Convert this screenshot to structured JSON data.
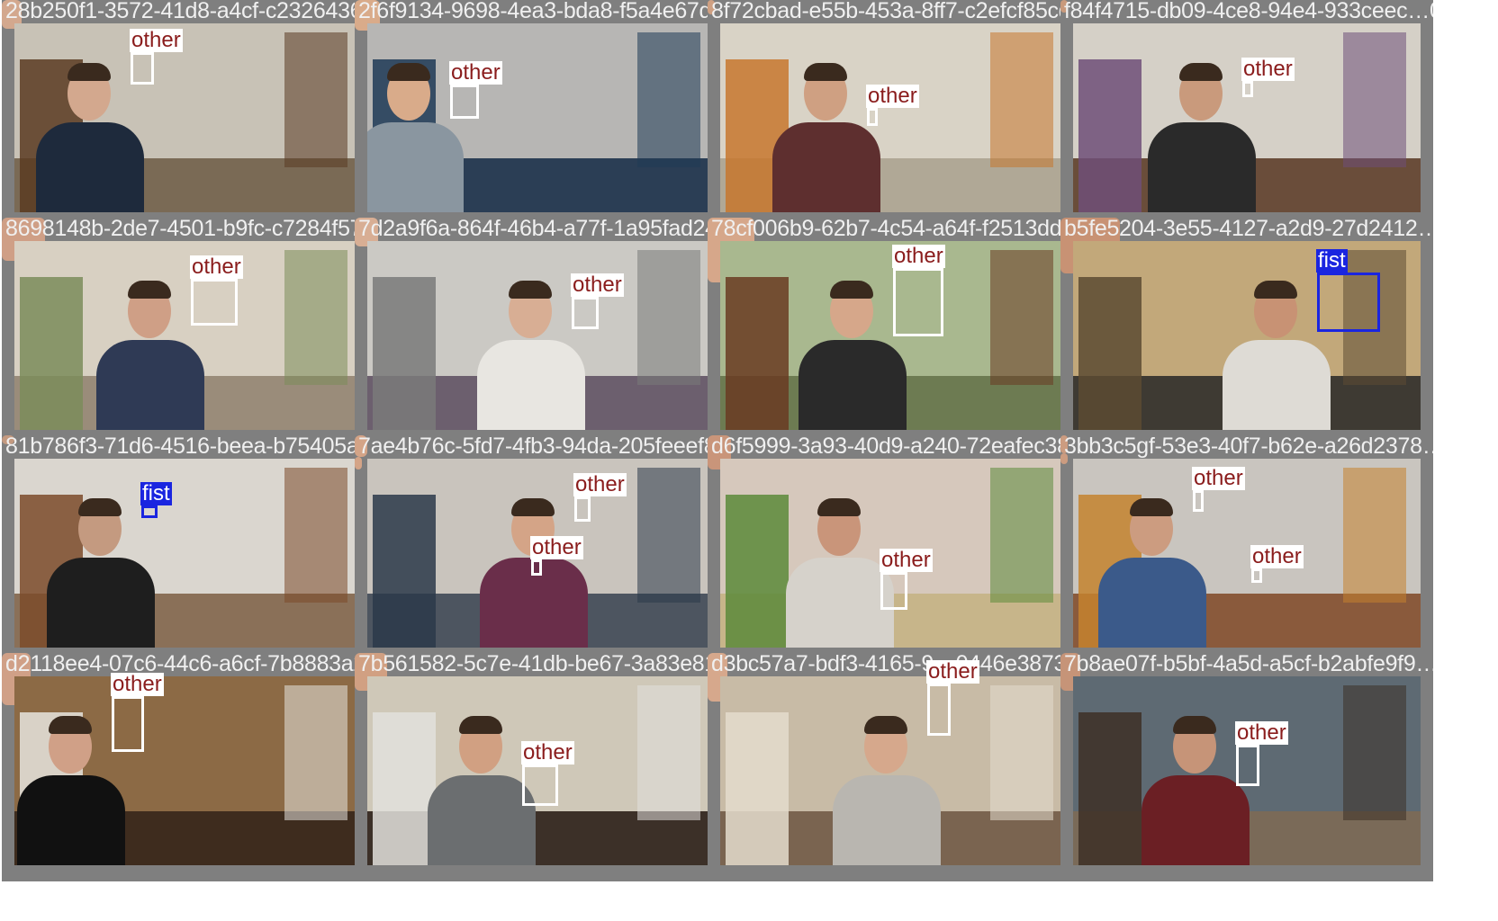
{
  "tiles": [
    {
      "filename": "28b250f1-3572-41d8-a4cf-c2326436d…1e3.jpg",
      "scene": {
        "wall": "#c8c2b6",
        "floor": "#7a6a55",
        "shirt": "#1e2a3c",
        "skin": "#d3a88e",
        "accent": "#5a3b22"
      },
      "detections": [
        {
          "label": "other",
          "color": "#ffffff",
          "text_color": "#8a1c1c"
        }
      ]
    },
    {
      "filename": "2f6f9134-9698-4ea3-bda8-f5a4e67d5721.jpg",
      "scene": {
        "wall": "#b7b6b4",
        "floor": "#2b3e55",
        "shirt": "#8a96a0",
        "skin": "#d9ab8a",
        "accent": "#1f3a56"
      },
      "detections": [
        {
          "label": "other",
          "color": "#ffffff",
          "text_color": "#8a1c1c"
        }
      ]
    },
    {
      "filename": "8f72cbad-e55b-453a-8ff7-c2efcf85cd09.jpg",
      "scene": {
        "wall": "#d9d3c6",
        "floor": "#b0a896",
        "shirt": "#5e2f2f",
        "skin": "#cfa082",
        "accent": "#c7772e"
      },
      "detections": [
        {
          "label": "other",
          "color": "#ffffff",
          "text_color": "#8a1c1c"
        }
      ]
    },
    {
      "filename": "f84f4715-db09-4ce8-94e4-933ceec…0.jpg",
      "scene": {
        "wall": "#d5d0c7",
        "floor": "#6a4d3a",
        "shirt": "#2a2a2a",
        "skin": "#c99a7c",
        "accent": "#6e4f78"
      },
      "detections": [
        {
          "label": "other",
          "color": "#ffffff",
          "text_color": "#8a1c1c"
        }
      ]
    },
    {
      "filename": "8698148b-2de7-4501-b9fc-c7284f577f12.jpg",
      "scene": {
        "wall": "#d8d0c2",
        "floor": "#9a8c7a",
        "shirt": "#2f3a55",
        "skin": "#cf9f86",
        "accent": "#7b8c5a"
      },
      "detections": [
        {
          "label": "other",
          "color": "#ffffff",
          "text_color": "#8a1c1c"
        }
      ]
    },
    {
      "filename": "7d2a9f6a-864f-46b4-a77f-1a95fad24788.jpg",
      "scene": {
        "wall": "#cbc9c4",
        "floor": "#6c5f6e",
        "shirt": "#e8e6e1",
        "skin": "#d8ae94",
        "accent": "#7a7a7a"
      },
      "detections": [
        {
          "label": "other",
          "color": "#ffffff",
          "text_color": "#8a1c1c"
        }
      ]
    },
    {
      "filename": "78cf006b9-62b7-4c54-a64f-f2513dd5b4fe.jpg",
      "scene": {
        "wall": "#a9b88f",
        "floor": "#6d7b52",
        "shirt": "#2a2a2a",
        "skin": "#d6a78a",
        "accent": "#6a3b22"
      },
      "detections": [
        {
          "label": "other",
          "color": "#ffffff",
          "text_color": "#8a1c1c"
        }
      ]
    },
    {
      "filename": "b5fe5204-3e55-4127-a2d9-27d2412…jpg",
      "scene": {
        "wall": "#c2a87a",
        "floor": "#3e3a33",
        "shirt": "#dedbd5",
        "skin": "#c89274",
        "accent": "#5c4b33"
      },
      "detections": [
        {
          "label": "fist",
          "color": "#1a25e0",
          "text_color": "#ffffff"
        }
      ]
    },
    {
      "filename": "81b786f3-71d6-4516-beea-b75405af7a47.jpg",
      "scene": {
        "wall": "#dad6cf",
        "floor": "#8a7058",
        "shirt": "#1e1e1e",
        "skin": "#c49a80",
        "accent": "#7b4b2a"
      },
      "detections": [
        {
          "label": "fist",
          "color": "#1a25e0",
          "text_color": "#ffffff"
        }
      ]
    },
    {
      "filename": "7ae4b76c-5fd7-4fb3-94da-205feeef8d46.jpg",
      "scene": {
        "wall": "#c9c4bd",
        "floor": "#4d5560",
        "shirt": "#6a2e4a",
        "skin": "#d4a487",
        "accent": "#2b3a4a"
      },
      "detections": [
        {
          "label": "other",
          "color": "#ffffff",
          "text_color": "#8a1c1c"
        },
        {
          "label": "other",
          "color": "#ffffff",
          "text_color": "#8a1c1c"
        }
      ]
    },
    {
      "filename": "d6f5999-3a93-40d9-a240-72eafec38bb3.jpg",
      "scene": {
        "wall": "#d6c8bc",
        "floor": "#c7b58a",
        "shirt": "#d6d2cb",
        "skin": "#c9957a",
        "accent": "#5c8a3a"
      },
      "detections": [
        {
          "label": "other",
          "color": "#ffffff",
          "text_color": "#8a1c1c"
        }
      ]
    },
    {
      "filename": "3bb3c5gf-53e3-40f7-b62e-a26d2378…jpg",
      "scene": {
        "wall": "#c9c5bf",
        "floor": "#8a5a3c",
        "shirt": "#3b5a8a",
        "skin": "#cc9c80",
        "accent": "#c4822e"
      },
      "detections": [
        {
          "label": "other",
          "color": "#ffffff",
          "text_color": "#8a1c1c"
        },
        {
          "label": "other",
          "color": "#ffffff",
          "text_color": "#8a1c1c"
        }
      ]
    },
    {
      "filename": "d2118ee4-07c6-44c6-a6cf-7b8883a22b56.jpg",
      "scene": {
        "wall": "#8c6a45",
        "floor": "#3e2c1e",
        "shirt": "#111111",
        "skin": "#d0a087",
        "accent": "#e6e4de"
      },
      "detections": [
        {
          "label": "other",
          "color": "#ffffff",
          "text_color": "#8a1c1c"
        }
      ]
    },
    {
      "filename": "7b561582-5c7e-41db-be67-3a83e816bbcc.jpg",
      "scene": {
        "wall": "#cfc8b8",
        "floor": "#3c3028",
        "shirt": "#6b6e70",
        "skin": "#d1a082",
        "accent": "#e2e0dc"
      },
      "detections": [
        {
          "label": "other",
          "color": "#ffffff",
          "text_color": "#8a1c1c"
        }
      ]
    },
    {
      "filename": "d3bc57a7-bdf3-4165-9…0446e387384a.jpg",
      "scene": {
        "wall": "#c8bba6",
        "floor": "#7a6450",
        "shirt": "#b9b6b0",
        "skin": "#d6a88c",
        "accent": "#e4dccd"
      },
      "detections": [
        {
          "label": "other",
          "color": "#ffffff",
          "text_color": "#8a1c1c"
        }
      ]
    },
    {
      "filename": "7b8ae07f-b5bf-4a5d-a5cf-b2abfe9f9…jpg",
      "scene": {
        "wall": "#5e6a73",
        "floor": "#7a6a58",
        "shirt": "#6b1f24",
        "skin": "#c69478",
        "accent": "#3d2f26"
      },
      "detections": [
        {
          "label": "other",
          "color": "#ffffff",
          "text_color": "#8a1c1c"
        }
      ]
    }
  ]
}
